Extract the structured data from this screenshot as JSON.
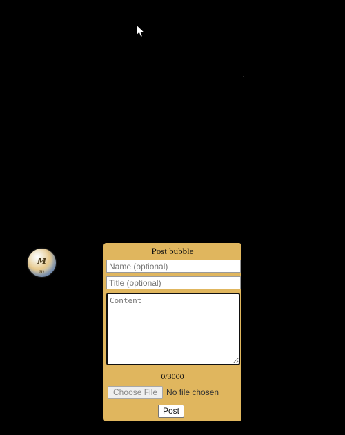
{
  "bubble": {
    "letter": "M",
    "sub": "m"
  },
  "form": {
    "title": "Post bubble",
    "name_placeholder": "Name (optional)",
    "title_placeholder": "Title (optional)",
    "content_placeholder": "Content",
    "counter": "0/3000",
    "file_button_label": "Choose File",
    "file_status": "No file chosen",
    "post_button_label": "Post"
  },
  "colors": {
    "background": "#000000",
    "panel": "#e0b65e"
  },
  "icons": {
    "cursor": "mouse-pointer-icon",
    "bubble": "bubble-avatar-icon"
  }
}
